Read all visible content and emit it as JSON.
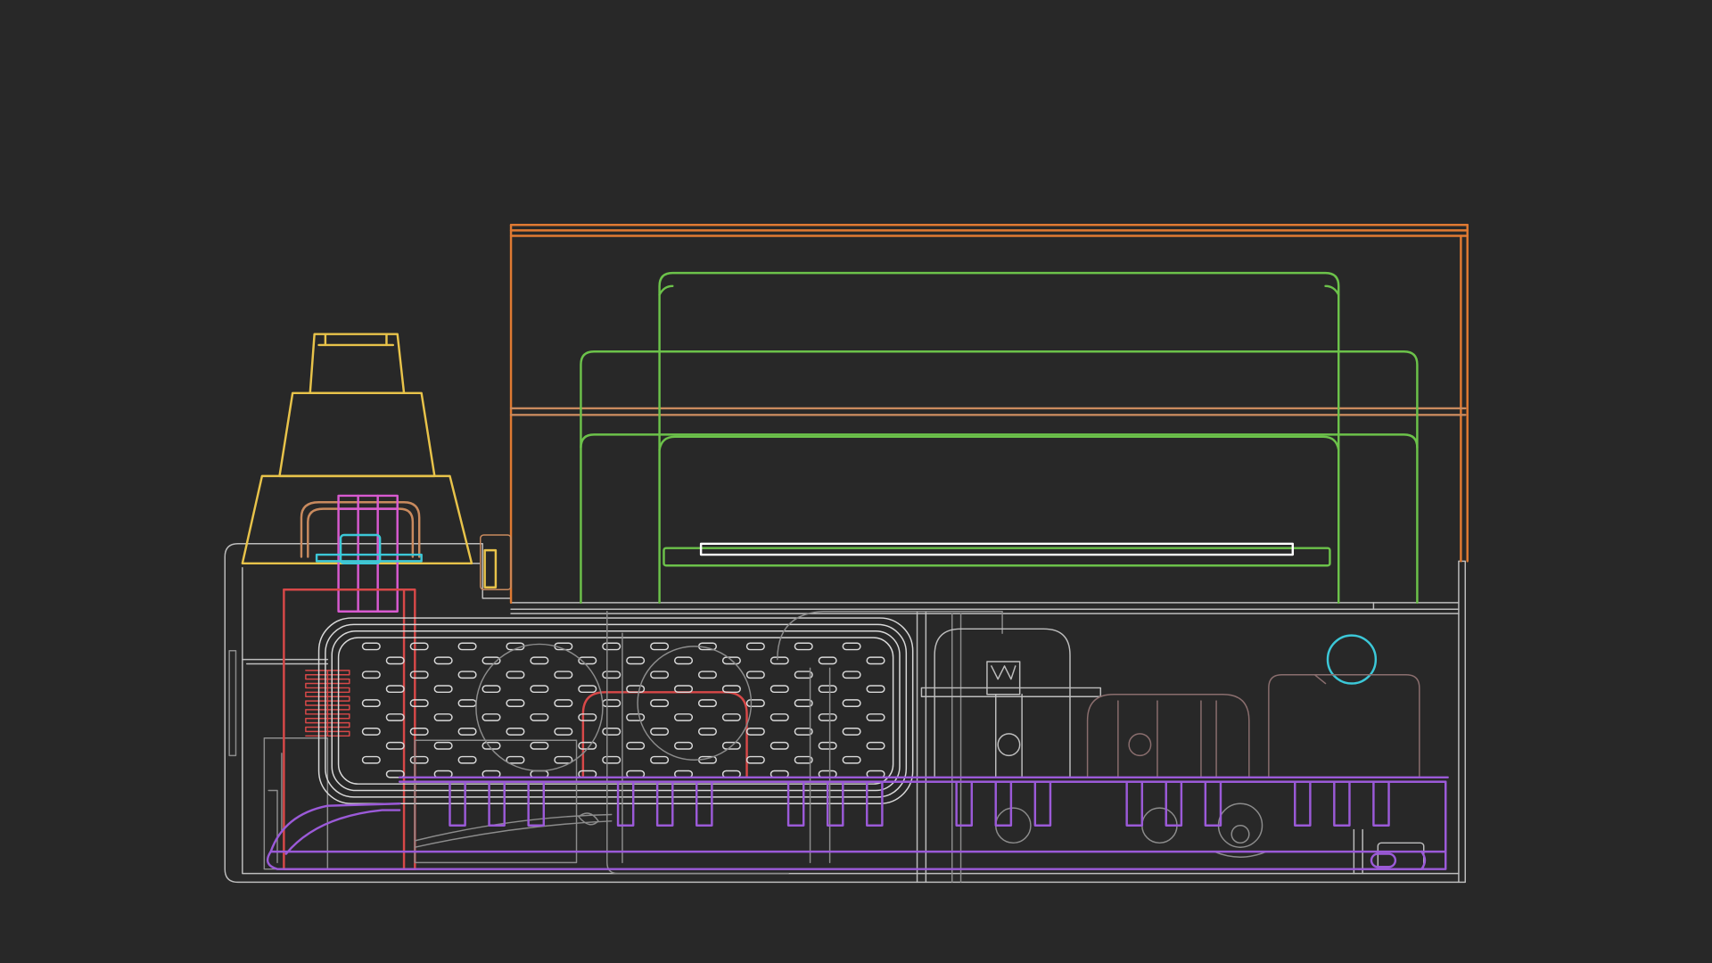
{
  "colors": {
    "background": "#282828",
    "housing": "#bdbdbd",
    "housing_faint": "#8c8c8c",
    "tank": "#d9d9d9",
    "top_cover": "#e07a32",
    "top_cover_mid": "#c98a5e",
    "tray": "#6cc24a",
    "tray_slot": "#ffffff",
    "funnel": "#e8c34a",
    "funnel_inner": "#c98a5e",
    "magenta_part": "#d85ad0",
    "cyan_part": "#3cc8d8",
    "red_part": "#d84848",
    "base_frame": "#9b5ad8",
    "module_outline": "#8a6e6e"
  },
  "diagram": {
    "type": "wireframe-cutaway",
    "labels": []
  }
}
